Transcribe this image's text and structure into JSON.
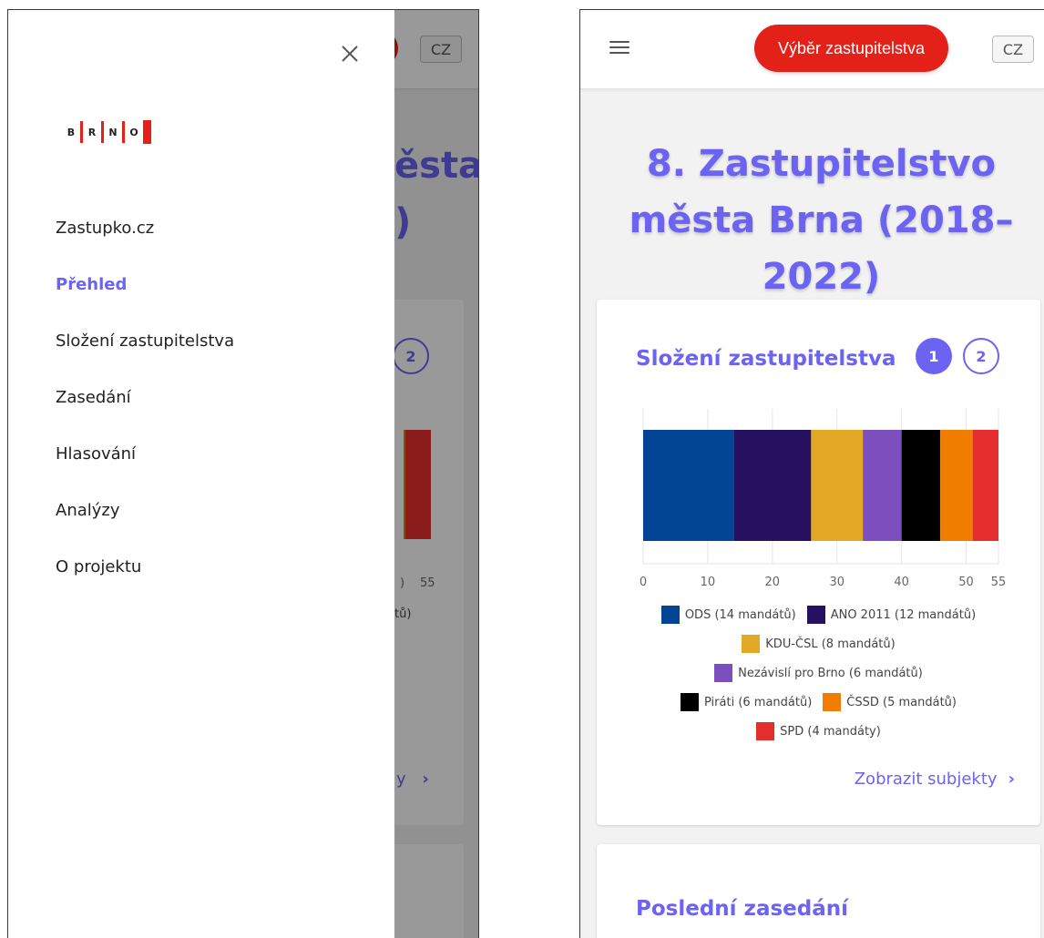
{
  "header": {
    "select_label": "Výběr zastupitelstva",
    "lang_label": "CZ"
  },
  "page": {
    "title": "8. Zastupitelstvo města Brna (2018–2022)"
  },
  "composition": {
    "title": "Složení zastupitelstva",
    "pages": [
      "1",
      "2"
    ],
    "active_page": 1,
    "show_link": "Zobrazit subjekty"
  },
  "last_session": {
    "title": "Poslední zasedání"
  },
  "drawer": {
    "logo_letters": [
      "B",
      "R",
      "N",
      "O"
    ],
    "menu": [
      {
        "label": "Zastupko.cz",
        "active": false
      },
      {
        "label": "Přehled",
        "active": true
      },
      {
        "label": "Složení zastupitelstva",
        "active": false
      },
      {
        "label": "Zasedání",
        "active": false
      },
      {
        "label": "Hlasování",
        "active": false
      },
      {
        "label": "Analýzy",
        "active": false
      },
      {
        "label": "O projektu",
        "active": false
      }
    ]
  },
  "background_peek": {
    "title_fragment": "ěsta",
    "title_fragment2": ")",
    "page_2": "2",
    "tick_a": ") ",
    "tick_b": "55",
    "legend_fragment": "tů)",
    "link_fragment": "y",
    "lang_label": "CZ"
  },
  "colors": {
    "accent": "#6c63f2",
    "brand_red": "#e32119"
  },
  "chart_data": {
    "type": "bar",
    "orientation": "horizontal-stacked",
    "categories": [
      "Složení zastupitelstva"
    ],
    "series": [
      {
        "name": "ODS (14 mandátů)",
        "values": [
          14
        ],
        "color": "#034595"
      },
      {
        "name": "ANO 2011 (12 mandátů)",
        "values": [
          12
        ],
        "color": "#261060"
      },
      {
        "name": "KDU-ČSL (8 mandátů)",
        "values": [
          8
        ],
        "color": "#e3a825"
      },
      {
        "name": "Nezávislí pro Brno (6 mandátů)",
        "values": [
          6
        ],
        "color": "#7c4fbe"
      },
      {
        "name": "Piráti (6 mandátů)",
        "values": [
          6
        ],
        "color": "#000000"
      },
      {
        "name": "ČSSD (5 mandátů)",
        "values": [
          5
        ],
        "color": "#f07d00"
      },
      {
        "name": "SPD (4 mandáty)",
        "values": [
          4
        ],
        "color": "#e42e2e"
      }
    ],
    "xlim": [
      0,
      55
    ],
    "xticks": [
      0,
      10,
      20,
      30,
      40,
      50,
      55
    ],
    "legend_rows": [
      [
        0,
        1
      ],
      [
        2
      ],
      [
        3
      ],
      [
        4,
        5
      ],
      [
        6
      ]
    ],
    "legend_position": "bottom",
    "grid": true,
    "title": "",
    "xlabel": "",
    "ylabel": ""
  }
}
